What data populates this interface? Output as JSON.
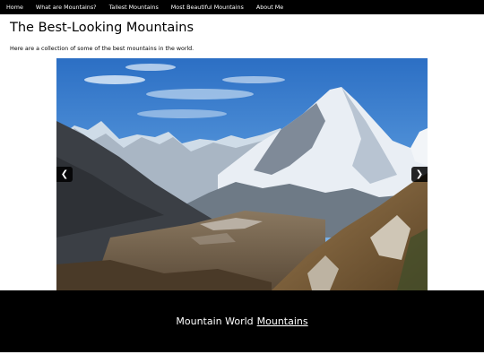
{
  "nav": {
    "items": [
      {
        "label": "Home"
      },
      {
        "label": "What are Mountains?"
      },
      {
        "label": "Tallest Mountains"
      },
      {
        "label": "Most Beautiful Mountains"
      },
      {
        "label": "About Me"
      }
    ]
  },
  "main": {
    "title": "The Best-Looking Mountains",
    "intro": "Here are a collection of some of the best mountains in the world."
  },
  "slideshow": {
    "prev_label": "❮",
    "next_label": "❯",
    "image_icon": "mountain-landscape-photo"
  },
  "footer": {
    "text": "Mountain World",
    "link_label": "Mountains"
  },
  "colors": {
    "nav_bg": "#000000",
    "footer_bg": "#000000",
    "sky": "#3a7fd0"
  }
}
